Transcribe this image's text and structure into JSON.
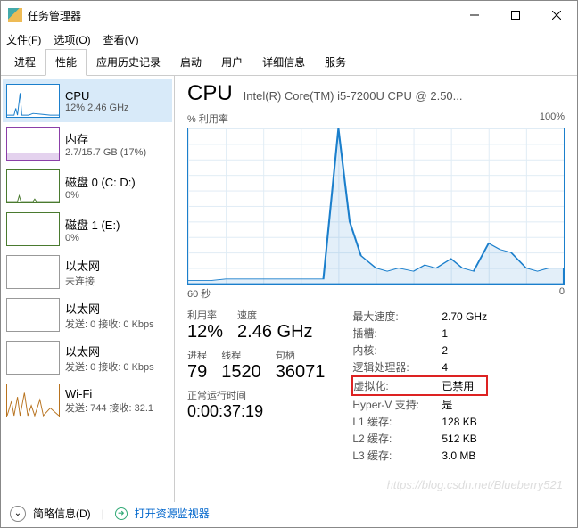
{
  "window": {
    "title": "任务管理器"
  },
  "menubar": {
    "file": "文件(F)",
    "options": "选项(O)",
    "view": "查看(V)"
  },
  "tabs": [
    {
      "id": "processes",
      "label": "进程"
    },
    {
      "id": "performance",
      "label": "性能"
    },
    {
      "id": "app-history",
      "label": "应用历史记录"
    },
    {
      "id": "startup",
      "label": "启动"
    },
    {
      "id": "users",
      "label": "用户"
    },
    {
      "id": "details",
      "label": "详细信息"
    },
    {
      "id": "services",
      "label": "服务"
    }
  ],
  "sidebar": [
    {
      "id": "cpu",
      "title": "CPU",
      "sub": "12% 2.46 GHz",
      "selected": true
    },
    {
      "id": "mem",
      "title": "内存",
      "sub": "2.7/15.7 GB (17%)"
    },
    {
      "id": "disk0",
      "title": "磁盘 0 (C: D:)",
      "sub": "0%"
    },
    {
      "id": "disk1",
      "title": "磁盘 1 (E:)",
      "sub": "0%"
    },
    {
      "id": "eth0",
      "title": "以太网",
      "sub": "未连接"
    },
    {
      "id": "eth1",
      "title": "以太网",
      "sub": "发送: 0 接收: 0 Kbps"
    },
    {
      "id": "eth2",
      "title": "以太网",
      "sub": "发送: 0 接收: 0 Kbps"
    },
    {
      "id": "wifi",
      "title": "Wi-Fi",
      "sub": "发送: 744 接收: 32.1"
    }
  ],
  "main": {
    "title": "CPU",
    "model": "Intel(R) Core(TM) i5-7200U CPU @ 2.50...",
    "chart_top_left": "% 利用率",
    "chart_top_right": "100%",
    "chart_bottom_left": "60 秒",
    "chart_bottom_right": "0"
  },
  "stats": {
    "util_label": "利用率",
    "util_value": "12%",
    "speed_label": "速度",
    "speed_value": "2.46 GHz",
    "proc_label": "进程",
    "proc_value": "79",
    "threads_label": "线程",
    "threads_value": "1520",
    "handles_label": "句柄",
    "handles_value": "36071",
    "uptime_label": "正常运行时间",
    "uptime_value": "0:00:37:19"
  },
  "right": {
    "max_speed_label": "最大速度:",
    "max_speed": "2.70 GHz",
    "sockets_label": "插槽:",
    "sockets": "1",
    "cores_label": "内核:",
    "cores": "2",
    "logical_label": "逻辑处理器:",
    "logical": "4",
    "virt_label": "虚拟化:",
    "virt": "已禁用",
    "hyperv_label": "Hyper-V 支持:",
    "hyperv": "是",
    "l1_label": "L1 缓存:",
    "l1": "128 KB",
    "l2_label": "L2 缓存:",
    "l2": "512 KB",
    "l3_label": "L3 缓存:",
    "l3": "3.0 MB"
  },
  "footer": {
    "brief": "简略信息(D)",
    "resmon": "打开资源监视器"
  },
  "watermark": "https://blog.csdn.net/Blueberry521",
  "chart_data": {
    "type": "line",
    "title": "% 利用率",
    "xlabel": "60 秒 → 0",
    "ylabel": "% 利用率",
    "ylim": [
      0,
      100
    ],
    "x_seconds_ago": [
      60,
      58,
      56,
      54,
      52,
      50,
      48,
      46,
      44,
      42,
      40,
      38,
      36,
      34,
      32,
      30,
      28,
      26,
      24,
      22,
      20,
      18,
      16,
      14,
      12,
      10,
      8,
      6,
      4,
      2,
      0
    ],
    "values": [
      2,
      2,
      2,
      3,
      3,
      3,
      3,
      3,
      3,
      3,
      3,
      3,
      100,
      40,
      18,
      10,
      8,
      10,
      8,
      12,
      10,
      16,
      10,
      8,
      26,
      22,
      20,
      10,
      8,
      10,
      10
    ]
  }
}
